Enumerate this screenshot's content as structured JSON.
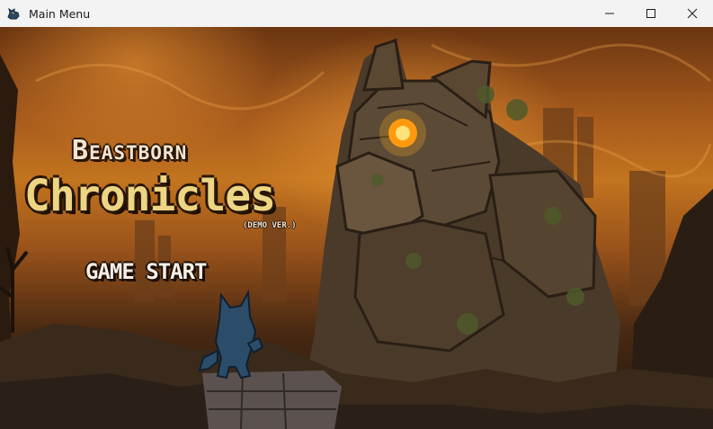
{
  "window": {
    "title": "Main Menu",
    "app_icon": "dragon-icon",
    "controls": [
      "minimize-icon",
      "maximize-icon",
      "close-icon"
    ]
  },
  "menu": {
    "logo_top": "Beastborn",
    "logo_main": "Chronicles",
    "logo_sub": "(DEMO VER.)",
    "start_label": "GAME START"
  },
  "colors": {
    "title_text": "#f3e4cf",
    "title_main": "#ecd583",
    "golem_eye": "#ffb21e",
    "sky_orange": "#c3741f"
  }
}
